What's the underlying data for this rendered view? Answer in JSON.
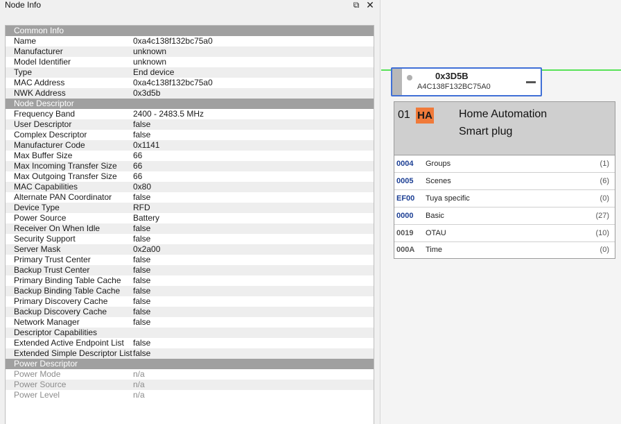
{
  "panel": {
    "title": "Node Info",
    "float_icon": "⧉",
    "close_icon": "✕"
  },
  "rows": [
    {
      "type": "section",
      "key": "Common Info",
      "value": ""
    },
    {
      "type": "item",
      "key": "Name",
      "value": "0xa4c138f132bc75a0"
    },
    {
      "type": "item",
      "key": "Manufacturer",
      "value": "unknown"
    },
    {
      "type": "item",
      "key": "Model Identifier",
      "value": "unknown"
    },
    {
      "type": "item",
      "key": "Type",
      "value": "End device"
    },
    {
      "type": "item",
      "key": "MAC Address",
      "value": "0xa4c138f132bc75a0"
    },
    {
      "type": "item",
      "key": "NWK Address",
      "value": "0x3d5b"
    },
    {
      "type": "section",
      "key": "Node Descriptor",
      "value": ""
    },
    {
      "type": "item",
      "key": "Frequency Band",
      "value": "2400 - 2483.5 MHz"
    },
    {
      "type": "item",
      "key": "User Descriptor",
      "value": "false"
    },
    {
      "type": "item",
      "key": "Complex Descriptor",
      "value": "false"
    },
    {
      "type": "item",
      "key": "Manufacturer Code",
      "value": "0x1141"
    },
    {
      "type": "item",
      "key": "Max Buffer Size",
      "value": "66"
    },
    {
      "type": "item",
      "key": "Max Incoming Transfer Size",
      "value": "66"
    },
    {
      "type": "item",
      "key": "Max Outgoing Transfer Size",
      "value": "66"
    },
    {
      "type": "item",
      "key": "MAC Capabilities",
      "value": "0x80"
    },
    {
      "type": "item",
      "key": "Alternate PAN Coordinator",
      "value": "false"
    },
    {
      "type": "item",
      "key": "Device Type",
      "value": "RFD"
    },
    {
      "type": "item",
      "key": "Power Source",
      "value": "Battery"
    },
    {
      "type": "item",
      "key": "Receiver On When Idle",
      "value": "false"
    },
    {
      "type": "item",
      "key": "Security Support",
      "value": "false"
    },
    {
      "type": "item",
      "key": "Server Mask",
      "value": "0x2a00"
    },
    {
      "type": "item",
      "key": "Primary Trust Center",
      "value": "false"
    },
    {
      "type": "item",
      "key": "Backup Trust Center",
      "value": "false"
    },
    {
      "type": "item",
      "key": "Primary Binding Table Cache",
      "value": "false"
    },
    {
      "type": "item",
      "key": "Backup Binding Table Cache",
      "value": "false"
    },
    {
      "type": "item",
      "key": "Primary Discovery Cache",
      "value": "false"
    },
    {
      "type": "item",
      "key": "Backup Discovery Cache",
      "value": "false"
    },
    {
      "type": "item",
      "key": "Network Manager",
      "value": "false"
    },
    {
      "type": "item",
      "key": "Descriptor Capabilities",
      "value": ""
    },
    {
      "type": "item",
      "key": "Extended Active Endpoint List",
      "value": "false"
    },
    {
      "type": "item",
      "key": "Extended Simple Descriptor List",
      "value": "false"
    },
    {
      "type": "section",
      "key": "Power Descriptor",
      "value": ""
    },
    {
      "type": "dim",
      "key": "Power Mode",
      "value": "n/a"
    },
    {
      "type": "dim",
      "key": "Power Source",
      "value": "n/a"
    },
    {
      "type": "dim",
      "key": "Power Level",
      "value": "n/a"
    }
  ],
  "node": {
    "nwk": "0x3D5B",
    "mac": "A4C138F132BC75A0"
  },
  "endpoint": {
    "number": "01",
    "badge": "HA",
    "profile": "Home Automation",
    "device": "Smart plug",
    "clusters": [
      {
        "id": "0004",
        "name": "Groups",
        "count": "(1)",
        "side": "server"
      },
      {
        "id": "0005",
        "name": "Scenes",
        "count": "(6)",
        "side": "server"
      },
      {
        "id": "EF00",
        "name": "Tuya specific",
        "count": "(0)",
        "side": "server"
      },
      {
        "id": "0000",
        "name": "Basic",
        "count": "(27)",
        "side": "server"
      },
      {
        "id": "0019",
        "name": "OTAU",
        "count": "(10)",
        "side": "client"
      },
      {
        "id": "000A",
        "name": "Time",
        "count": "(0)",
        "side": "client"
      }
    ]
  },
  "colors": {
    "section_bg": "#a0a0a0",
    "selected_border": "#3f6fd6",
    "ha_badge": "#f07a3a",
    "link_green": "#57e257",
    "server_cluster_id": "#1c3f94"
  }
}
